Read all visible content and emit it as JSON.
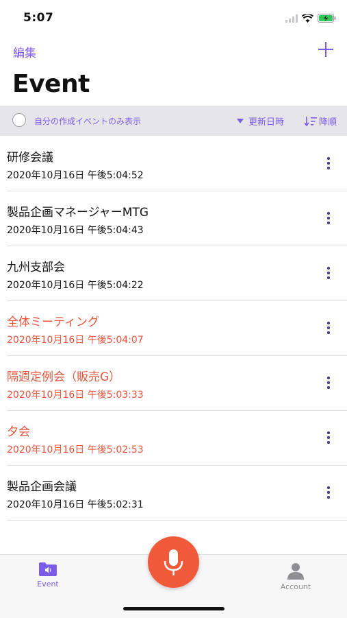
{
  "status": {
    "time": "5:07"
  },
  "nav": {
    "edit_label": "編集",
    "title": "Event"
  },
  "filter": {
    "label": "自分の作成イベントのみ表示",
    "sort_field": "更新日時",
    "sort_order": "降順"
  },
  "events": [
    {
      "title": "研修会議",
      "date": "2020年10月16日 午後5:04:52",
      "highlight": false
    },
    {
      "title": "製品企画マネージャーMTG",
      "date": "2020年10月16日 午後5:04:43",
      "highlight": false
    },
    {
      "title": "九州支部会",
      "date": "2020年10月16日 午後5:04:22",
      "highlight": false
    },
    {
      "title": "全体ミーティング",
      "date": "2020年10月16日 午後5:04:07",
      "highlight": true
    },
    {
      "title": "隔週定例会（販売G）",
      "date": "2020年10月16日 午後5:03:33",
      "highlight": true
    },
    {
      "title": "夕会",
      "date": "2020年10月16日 午後5:02:53",
      "highlight": true
    },
    {
      "title": "製品企画会議",
      "date": "2020年10月16日 午後5:02:31",
      "highlight": false
    }
  ],
  "tabs": {
    "event_label": "Event",
    "account_label": "Account"
  },
  "colors": {
    "accent": "#7b5ce6",
    "highlight": "#e8553a",
    "mic": "#f05a3a"
  },
  "icons": {
    "mic": "microphone-icon",
    "event_tab": "folder-speaker-icon",
    "account_tab": "person-icon"
  }
}
